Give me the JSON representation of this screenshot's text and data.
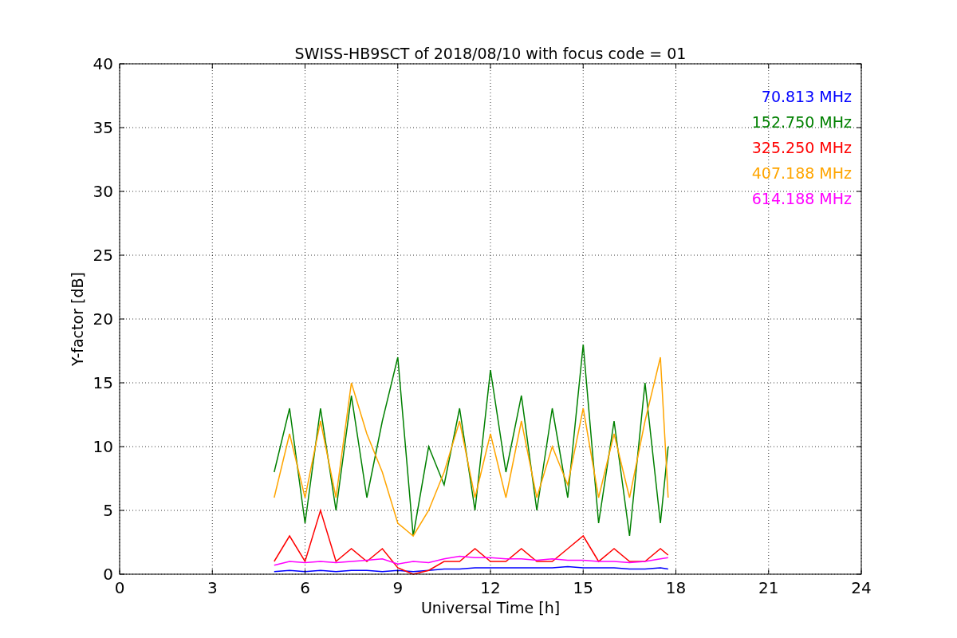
{
  "figure": {
    "chart_data": {
      "type": "line",
      "title": "SWISS-HB9SCT of 2018/08/10 with focus code = 01",
      "xlabel": "Universal Time [h]",
      "ylabel": "Y-factor [dB]",
      "x": [
        5,
        5.5,
        6,
        6.5,
        7,
        7.5,
        8,
        8.5,
        9,
        9.5,
        10,
        10.5,
        11,
        11.5,
        12,
        12.5,
        13,
        13.5,
        14,
        14.5,
        15,
        15.5,
        16,
        16.5,
        17,
        17.5,
        17.75
      ],
      "series": [
        {
          "name": "70.813 MHz",
          "color": "#0000ff",
          "values": [
            0.2,
            0.3,
            0.2,
            0.3,
            0.2,
            0.3,
            0.3,
            0.2,
            0.3,
            0.2,
            0.3,
            0.4,
            0.4,
            0.5,
            0.5,
            0.5,
            0.5,
            0.5,
            0.5,
            0.6,
            0.5,
            0.5,
            0.5,
            0.4,
            0.4,
            0.5,
            0.4
          ]
        },
        {
          "name": "152.750 MHz",
          "color": "#008000",
          "values": [
            8,
            13,
            4,
            13,
            5,
            14,
            6,
            12,
            17,
            3,
            10,
            7,
            13,
            5,
            16,
            8,
            14,
            5,
            13,
            6,
            18,
            4,
            12,
            3,
            15,
            4,
            10
          ]
        },
        {
          "name": "325.250 MHz",
          "color": "#ff0000",
          "values": [
            1,
            3,
            1,
            5,
            1,
            2,
            1,
            2,
            0.5,
            0,
            0.3,
            1,
            1,
            2,
            1,
            1,
            2,
            1,
            1,
            2,
            3,
            1,
            2,
            1,
            1,
            2,
            1.5
          ]
        },
        {
          "name": "407.188 MHz",
          "color": "#ffa500",
          "values": [
            6,
            11,
            6,
            12,
            6,
            15,
            11,
            8,
            4,
            3,
            5,
            8,
            12,
            6,
            11,
            6,
            12,
            6,
            10,
            7,
            13,
            6,
            11,
            6,
            12,
            17,
            6
          ]
        },
        {
          "name": "614.188 MHz",
          "color": "#ff00ff",
          "values": [
            0.7,
            1,
            0.9,
            1,
            0.9,
            1,
            1.1,
            1.2,
            0.8,
            1,
            0.9,
            1.2,
            1.4,
            1.3,
            1.3,
            1.2,
            1.2,
            1.1,
            1.2,
            1.1,
            1.1,
            1,
            1,
            0.9,
            1,
            1.2,
            1.3
          ]
        }
      ],
      "grid": true,
      "xlim": [
        0,
        24
      ],
      "ylim": [
        0,
        40
      ],
      "xticks": [
        0,
        3,
        6,
        9,
        12,
        15,
        18,
        21,
        24
      ],
      "yticks": [
        0,
        5,
        10,
        15,
        20,
        25,
        30,
        35,
        40
      ]
    }
  }
}
